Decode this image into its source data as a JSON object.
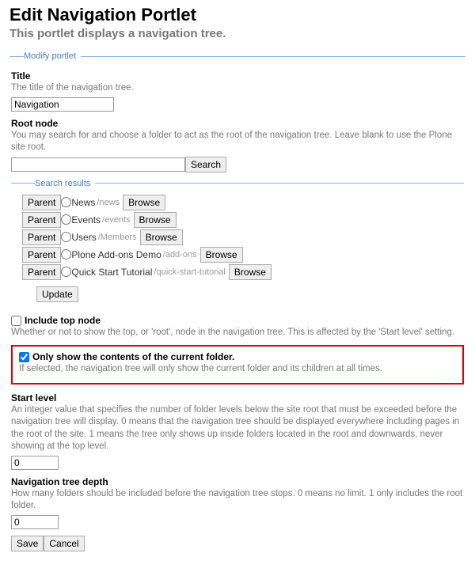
{
  "header": {
    "title": "Edit Navigation Portlet",
    "subtitle": "This portlet displays a navigation tree."
  },
  "legend_modify": "Modify portlet",
  "title_field": {
    "label": "Title",
    "help": "The title of the navigation tree.",
    "value": "Navigation"
  },
  "root_node": {
    "label": "Root node",
    "help": "You may search for and choose a folder to act as the root of the navigation tree. Leave blank to use the Plone site root.",
    "value": "",
    "search_btn": "Search"
  },
  "legend_search": "Search results",
  "parent_btn": "Parent",
  "browse_btn": "Browse",
  "update_btn": "Update",
  "results": [
    {
      "name": "News",
      "path": "/news"
    },
    {
      "name": "Events",
      "path": "/events"
    },
    {
      "name": "Users",
      "path": "/Members"
    },
    {
      "name": "Plone Add-ons Demo",
      "path": "/add-ons"
    },
    {
      "name": "Quick Start Tutorial",
      "path": "/quick-start-tutorial"
    }
  ],
  "include_top": {
    "label": "Include top node",
    "help": "Whether or not to show the top, or 'root', node in the navigation tree. This is affected by the 'Start level' setting.",
    "checked": false
  },
  "only_current": {
    "label": "Only show the contents of the current folder.",
    "help": "If selected, the navigation tree will only show the current folder and its children at all times.",
    "checked": true
  },
  "start_level": {
    "label": "Start level",
    "help": "An integer value that specifies the number of folder levels below the site root that must be exceeded before the navigation tree will display. 0 means that the navigation tree should be displayed everywhere including pages in the root of the site. 1 means the tree only shows up inside folders located in the root and downwards, never showing at the top level.",
    "value": "0"
  },
  "tree_depth": {
    "label": "Navigation tree depth",
    "help": "How many folders should be included before the navigation tree stops. 0 means no limit. 1 only includes the root folder.",
    "value": "0"
  },
  "actions": {
    "save": "Save",
    "cancel": "Cancel"
  }
}
